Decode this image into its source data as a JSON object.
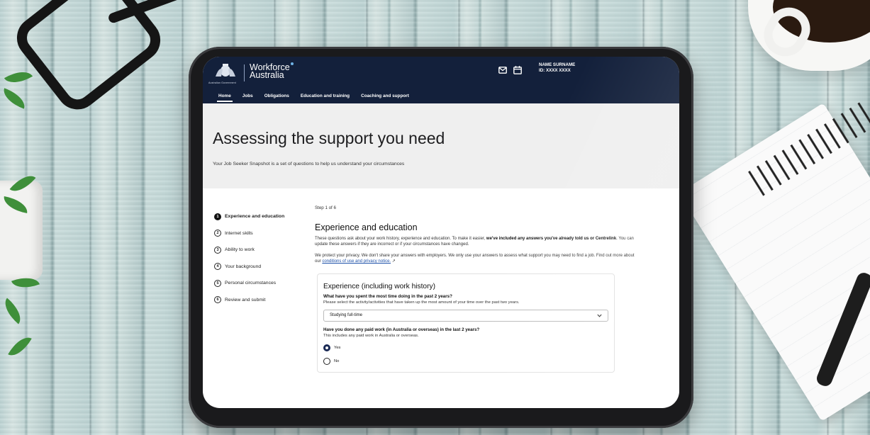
{
  "header": {
    "crest_caption": "Australian Government",
    "brand_line1": "Workforce",
    "brand_line2": "Australia",
    "user_name": "NAME SURNAME",
    "user_id": "ID: XXXX XXXX",
    "icons": [
      "mail-icon",
      "calendar-icon"
    ]
  },
  "nav": {
    "items": [
      {
        "label": "Home"
      },
      {
        "label": "Jobs"
      },
      {
        "label": "Obligations"
      },
      {
        "label": "Education and training"
      },
      {
        "label": "Coaching and support"
      }
    ]
  },
  "hero": {
    "title": "Assessing the support you need",
    "subtitle": "Your Job Seeker Snapshot is a set of questions to help us understand your circumstances"
  },
  "steps": [
    {
      "num": "1",
      "label": "Experience and education"
    },
    {
      "num": "2",
      "label": "Internet skills"
    },
    {
      "num": "3",
      "label": "Ability to work"
    },
    {
      "num": "4",
      "label": "Your background"
    },
    {
      "num": "5",
      "label": "Personal circumstances"
    },
    {
      "num": "6",
      "label": "Review and submit"
    }
  ],
  "content": {
    "step_indicator": "Step 1 of 6",
    "section_title": "Experience and education",
    "intro_a": "These questions ask about your work history, experience and education. To make it easier, ",
    "intro_b": "we've included any answers you've already told us or Centrelink",
    "intro_c": ". You can update these answers if they are incorrect or if your circumstances have changed.",
    "privacy_a": "We protect your privacy. We don't share your answers with employers. We only use your answers to assess what support you may need to find a job. Find out more about our ",
    "privacy_link": "conditions of use and privacy notice.",
    "privacy_link_icon": "↗",
    "card_title": "Experience (including work history)",
    "q1": "What have you spent the most time doing in the past 2 years?",
    "q1_hint": "Please select the activity/activities that have taken up the most amount of your time over the past two years.",
    "q1_value": "Studying full-time",
    "q2": "Have you done any paid work (in Australia or overseas) in the last 2 years?",
    "q2_hint": "This includes any paid work in Australia or overseas.",
    "q2_options": [
      {
        "label": "Yes",
        "selected": true
      },
      {
        "label": "No",
        "selected": false
      }
    ]
  },
  "colors": {
    "header_bg": "#13203b",
    "hero_bg": "#efefef",
    "link": "#1b4fa8"
  }
}
